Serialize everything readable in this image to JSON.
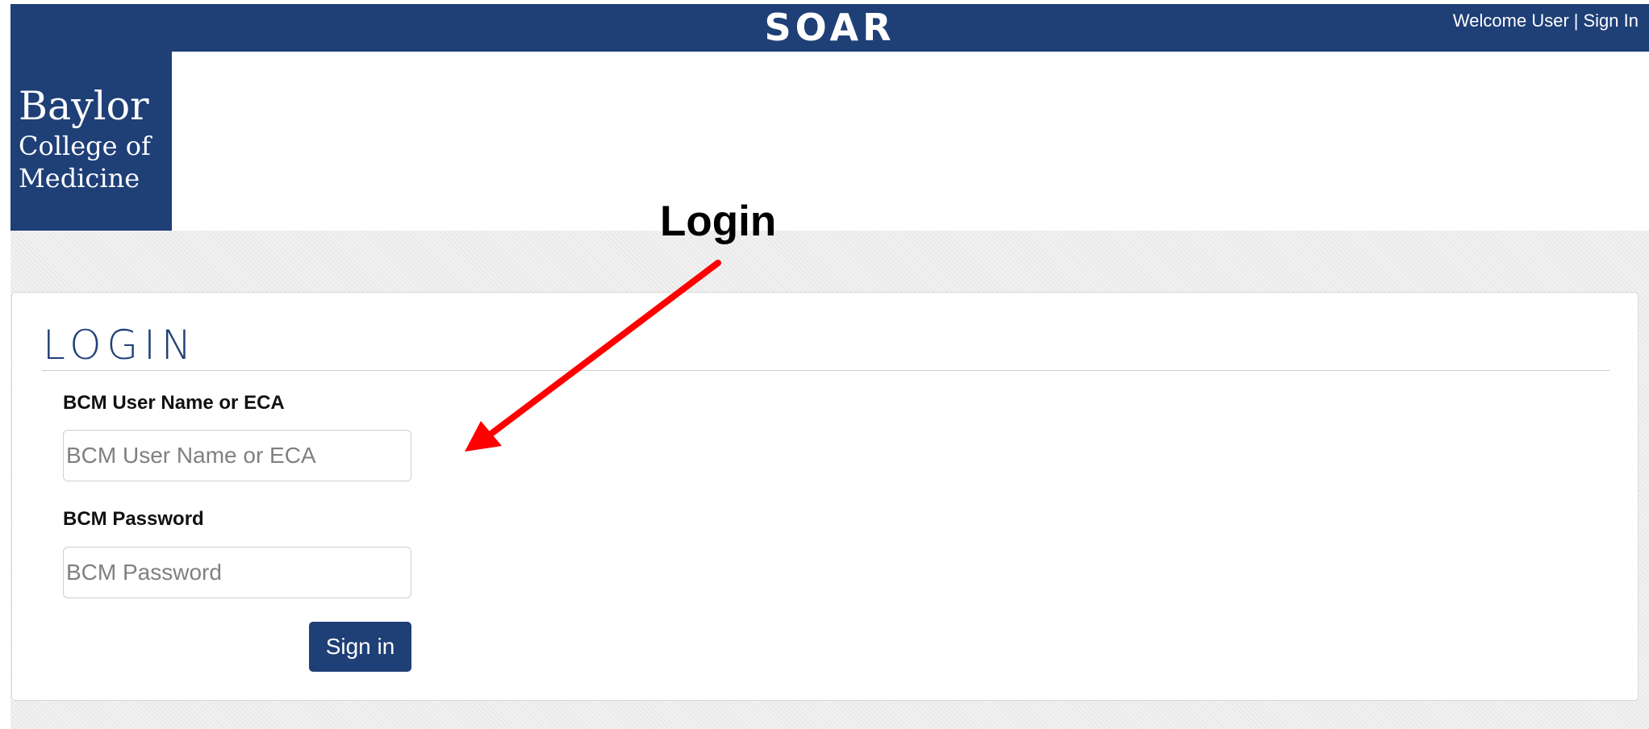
{
  "header": {
    "app_title": "SOAR",
    "welcome_text": "Welcome User",
    "separator": "|",
    "sign_in_link": "Sign In"
  },
  "logo": {
    "line1": "Baylor",
    "line2": "College of",
    "line3": "Medicine"
  },
  "annotation": {
    "label": "Login",
    "arrow_color": "#ff0000"
  },
  "login_form": {
    "title": "LOGIN",
    "username_label": "BCM User Name or ECA",
    "username_placeholder": "BCM User Name or ECA",
    "username_value": "",
    "password_label": "BCM Password",
    "password_placeholder": "BCM Password",
    "password_value": "",
    "submit_label": "Sign in"
  },
  "colors": {
    "brand_navy": "#1f3f77",
    "background_pattern": "#ececec"
  }
}
